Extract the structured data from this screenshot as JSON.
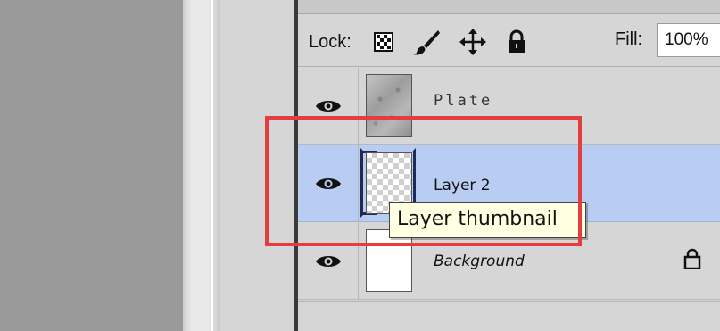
{
  "lock_row": {
    "lock_label": "Lock:",
    "icons": [
      "lock-transparent-pixels-icon",
      "lock-image-pixels-icon",
      "lock-position-icon",
      "lock-all-icon"
    ],
    "fill_label": "Fill:",
    "fill_value": "100%"
  },
  "layers": [
    {
      "name": "Plate",
      "visible": true,
      "thumbnail": "texture",
      "selected": false,
      "locked": false
    },
    {
      "name": "Layer 2",
      "visible": true,
      "thumbnail": "transparent",
      "selected": true,
      "locked": false
    },
    {
      "name": "Background",
      "visible": true,
      "thumbnail": "white",
      "selected": false,
      "locked": true
    }
  ],
  "tooltip": {
    "text": "Layer thumbnail"
  },
  "colors": {
    "selected_row": "#b9cdf2",
    "highlight": "#e53c3c",
    "tooltip_bg": "#ffffe1",
    "panel_bg": "#d6d6d6"
  }
}
